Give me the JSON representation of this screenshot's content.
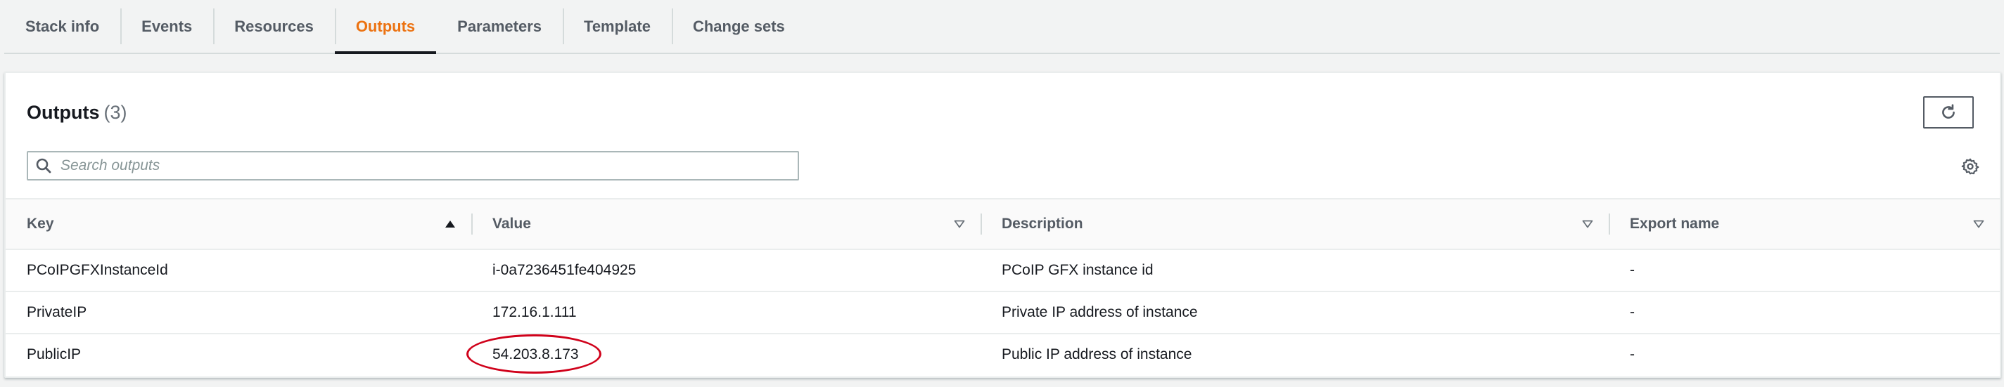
{
  "tabs": [
    {
      "label": "Stack info",
      "active": false
    },
    {
      "label": "Events",
      "active": false
    },
    {
      "label": "Resources",
      "active": false
    },
    {
      "label": "Outputs",
      "active": true
    },
    {
      "label": "Parameters",
      "active": false
    },
    {
      "label": "Template",
      "active": false
    },
    {
      "label": "Change sets",
      "active": false
    }
  ],
  "outputs": {
    "title": "Outputs",
    "count": "(3)",
    "search_placeholder": "Search outputs",
    "search_value": ""
  },
  "table": {
    "columns": [
      {
        "label": "Key",
        "sort": "ascending"
      },
      {
        "label": "Value",
        "sort": "none"
      },
      {
        "label": "Description",
        "sort": "none"
      },
      {
        "label": "Export name",
        "sort": "none"
      }
    ],
    "rows": [
      {
        "key": "PCoIPGFXInstanceId",
        "value": "i-0a7236451fe404925",
        "description": "PCoIP GFX instance id",
        "export": "-"
      },
      {
        "key": "PrivateIP",
        "value": "172.16.1.111",
        "description": "Private IP address of instance",
        "export": "-"
      },
      {
        "key": "PublicIP",
        "value": "54.203.8.173",
        "description": "Public IP address of instance",
        "export": "-"
      }
    ]
  },
  "icons": {
    "refresh": "refresh-icon",
    "search": "search-icon",
    "settings": "gear-icon",
    "sort_asc": "caret-up-filled-icon",
    "sort_none": "caret-down-outline-icon"
  },
  "colors": {
    "active_tab": "#ec7211",
    "annotation": "#d0021b"
  }
}
